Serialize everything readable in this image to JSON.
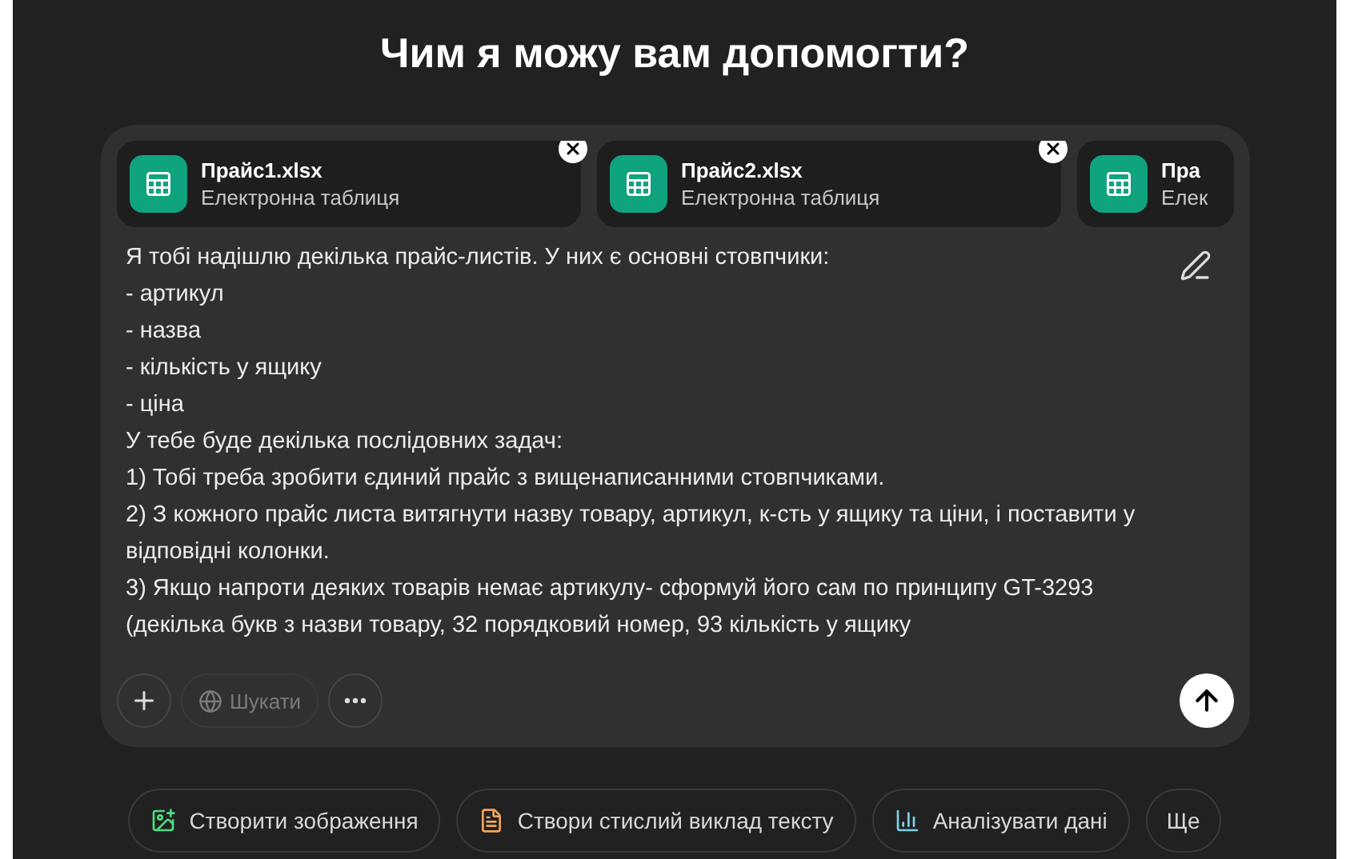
{
  "title": "Чим я можу вам допомогти?",
  "attachments": [
    {
      "name": "Прайс1.xlsx",
      "type": "Електронна таблиця",
      "removable": true
    },
    {
      "name": "Прайс2.xlsx",
      "type": "Електронна таблиця",
      "removable": true
    },
    {
      "name": "Пра",
      "type": "Елек",
      "removable": false
    }
  ],
  "message_lines": [
    "Я тобі надішлю декілька прайс-листів. У них є основні стовпчики:",
    "- артикул",
    "- назва",
    "- кількість у ящику",
    "- ціна",
    "У тебе буде декілька послідовних задач:",
    "1) Тобі треба зробити єдиний прайс з вищенаписанними стовпчиками.",
    "2) З кожного прайс листа витягнути назву товару, артикул, к-сть у ящику та ціни, і поставити у відповідні колонки.",
    "3) Якщо напроти деяких товарів немає артикулу- сформуй його сам по принципу GT-3293",
    "(декілька букв з назви товару, 32 порядковий номер, 93 кількість у ящику"
  ],
  "toolbar": {
    "search_label": "Шукати"
  },
  "suggestions": [
    {
      "kind": "image",
      "label": "Створити зображення",
      "color": "#4ade80"
    },
    {
      "kind": "summary",
      "label": "Створи стислий виклад тексту",
      "color": "#f0a55a"
    },
    {
      "kind": "analyze",
      "label": "Аналізувати дані",
      "color": "#7dd3e8"
    },
    {
      "kind": "more",
      "label": "Ще"
    }
  ]
}
